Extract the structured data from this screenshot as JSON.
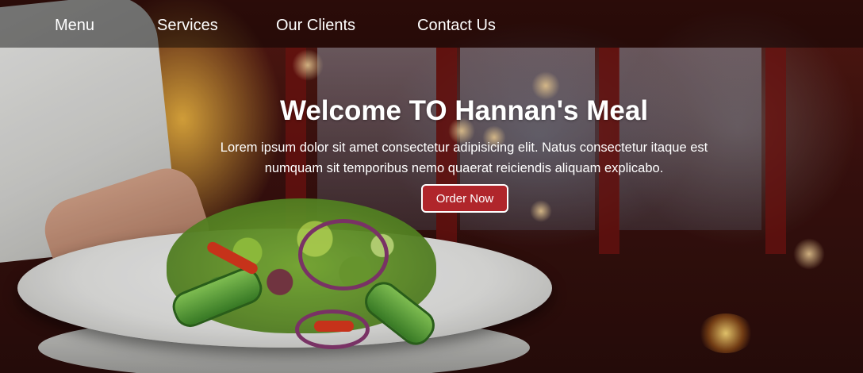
{
  "nav": {
    "items": [
      {
        "label": "Menu"
      },
      {
        "label": "Services"
      },
      {
        "label": "Our Clients"
      },
      {
        "label": "Contact Us"
      }
    ]
  },
  "hero": {
    "title": "Welcome TO Hannan's Meal",
    "description": "Lorem ipsum dolor sit amet consectetur adipisicing elit. Natus consectetur itaque est numquam sit temporibus nemo quaerat reiciendis aliquam explicabo.",
    "cta_label": "Order Now"
  },
  "colors": {
    "accent": "#b0262b",
    "nav_background": "rgba(0,0,0,0.45)",
    "text": "#ffffff"
  }
}
